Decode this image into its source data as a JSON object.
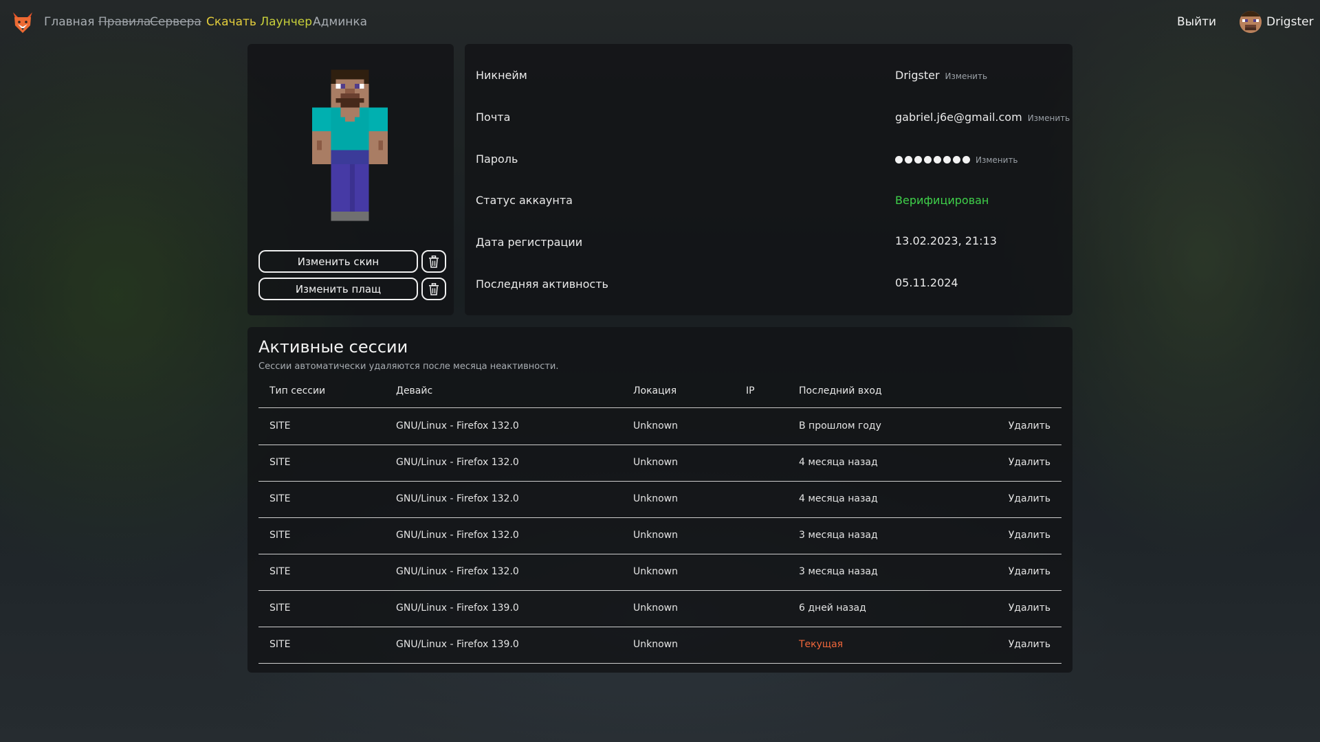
{
  "nav": {
    "links": [
      {
        "label": "Главная"
      },
      {
        "label": "Правила"
      },
      {
        "label": "Сервера"
      },
      {
        "label_part1": "Скачать",
        "label_part2": "Лаунчер"
      },
      {
        "label": "Админка"
      }
    ],
    "logout_label": "Выйти",
    "username": "Drigster"
  },
  "skin": {
    "change_skin_label": "Изменить скин",
    "change_cape_label": "Изменить плащ"
  },
  "profile": {
    "nickname": {
      "label": "Никнейм",
      "value": "Drigster",
      "action": "Изменить"
    },
    "email": {
      "label": "Почта",
      "value": "gabriel.j6e@gmail.com",
      "action": "Изменить"
    },
    "password": {
      "label": "Пароль",
      "action": "Изменить"
    },
    "status": {
      "label": "Статус аккаунта",
      "value": "Верифицирован"
    },
    "registered": {
      "label": "Дата регистрации",
      "value": "13.02.2023, 21:13"
    },
    "last_activity": {
      "label": "Последняя активность",
      "value": "05.11.2024"
    }
  },
  "sessions": {
    "title": "Активные сессии",
    "subtitle": "Сессии автоматически удаляются после месяца неактивности.",
    "columns": [
      "Тип сессии",
      "Девайс",
      "Локация",
      "IP",
      "Последний вход"
    ],
    "rows": [
      {
        "type": "SITE",
        "device": "GNU/Linux - Firefox 132.0",
        "location": "Unknown",
        "ip": "",
        "last": "В прошлом году",
        "action": "Удалить"
      },
      {
        "type": "SITE",
        "device": "GNU/Linux - Firefox 132.0",
        "location": "Unknown",
        "ip": "",
        "last": "4 месяца назад",
        "action": "Удалить"
      },
      {
        "type": "SITE",
        "device": "GNU/Linux - Firefox 132.0",
        "location": "Unknown",
        "ip": "",
        "last": "4 месяца назад",
        "action": "Удалить"
      },
      {
        "type": "SITE",
        "device": "GNU/Linux - Firefox 132.0",
        "location": "Unknown",
        "ip": "",
        "last": "3 месяца назад",
        "action": "Удалить"
      },
      {
        "type": "SITE",
        "device": "GNU/Linux - Firefox 132.0",
        "location": "Unknown",
        "ip": "",
        "last": "3 месяца назад",
        "action": "Удалить"
      },
      {
        "type": "SITE",
        "device": "GNU/Linux - Firefox 139.0",
        "location": "Unknown",
        "ip": "",
        "last": "6 дней назад",
        "action": "Удалить"
      },
      {
        "type": "SITE",
        "device": "GNU/Linux - Firefox 139.0",
        "location": "Unknown",
        "ip": "",
        "last": "Текущая",
        "action": "Удалить"
      }
    ]
  },
  "colors": {
    "accent_download": "#e3cd3c",
    "verified": "#3fd14a",
    "current_session": "#f0663a"
  }
}
